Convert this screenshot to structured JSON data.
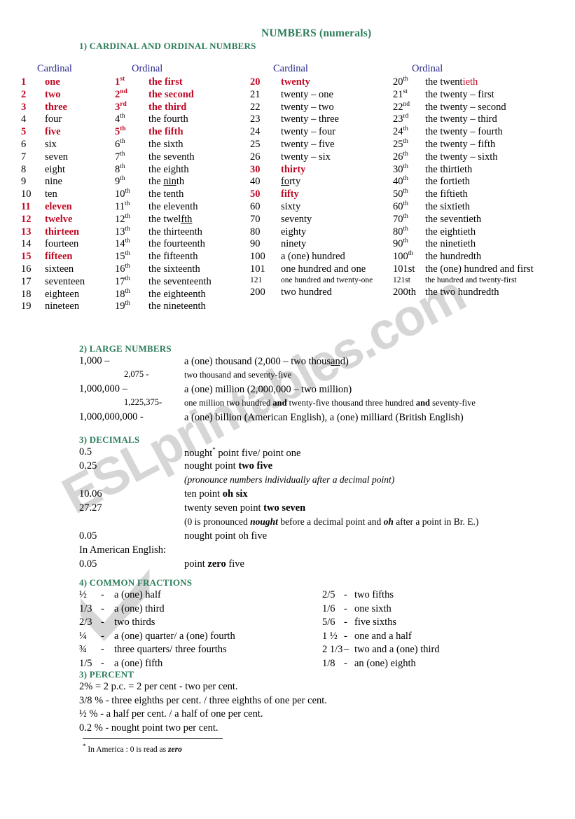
{
  "title": "NUMBERS (numerals)",
  "sections": {
    "cardinal_ordinal": "1) CARDINAL AND ORDINAL NUMBERS",
    "large_numbers": "2) LARGE NUMBERS",
    "decimals": "3) DECIMALS",
    "common_fractions": "4) COMMON FRACTIONS",
    "percent": "3) PERCENT"
  },
  "column_headers": {
    "cardinal_left": "Cardinal",
    "ordinal_left": "Ordinal",
    "cardinal_right": "Cardinal",
    "ordinal_right": "Ordinal"
  },
  "colors": {
    "heading_green": "#2e7d5b",
    "column_header_blue": "#2a2a8c",
    "highlight_red": "#bf0a25",
    "watermark_grey": "#d6d6d6"
  },
  "table_left": [
    {
      "num": "1",
      "cardinal": "one",
      "ord_num": "1",
      "ord_sup": "st",
      "ordinal": "the first",
      "red": true
    },
    {
      "num": "2",
      "cardinal": "two",
      "ord_num": "2",
      "ord_sup": "nd",
      "ordinal": "the second",
      "red": true
    },
    {
      "num": "3",
      "cardinal": "three",
      "ord_num": "3",
      "ord_sup": "rd",
      "ordinal": "the third",
      "red": true
    },
    {
      "num": "4",
      "cardinal": "four",
      "ord_num": "4",
      "ord_sup": "th",
      "ordinal": "the fourth",
      "red": false
    },
    {
      "num": "5",
      "cardinal": "five",
      "ord_num": "5",
      "ord_sup": "th",
      "ordinal": "the fifth",
      "red": true,
      "ord_num_red": true
    },
    {
      "num": "6",
      "cardinal": "six",
      "ord_num": "6",
      "ord_sup": "th",
      "ordinal": "the sixth",
      "red": false
    },
    {
      "num": "7",
      "cardinal": "seven",
      "ord_num": "7",
      "ord_sup": "th",
      "ordinal": "the seventh",
      "red": false
    },
    {
      "num": "8",
      "cardinal": "eight",
      "ord_num": "8",
      "ord_sup": "th",
      "ordinal": "the eighth",
      "red": false
    },
    {
      "num": "9",
      "cardinal": "nine",
      "ord_num": "9",
      "ord_sup": "th",
      "ordinal": "the ninth",
      "red": false,
      "underline": "nin"
    },
    {
      "num": "10",
      "cardinal": "ten",
      "ord_num": "10",
      "ord_sup": "th",
      "ordinal": "the tenth",
      "red": false
    },
    {
      "num": "11",
      "cardinal": "eleven",
      "ord_num": "11",
      "ord_sup": "th",
      "ordinal": "the eleventh",
      "red": false,
      "num_red": true
    },
    {
      "num": "12",
      "cardinal": "twelve",
      "ord_num": "12",
      "ord_sup": "th",
      "ordinal": "the twelfth",
      "red": false,
      "num_red": true,
      "underline": "fth"
    },
    {
      "num": "13",
      "cardinal": "thirteen",
      "ord_num": "13",
      "ord_sup": "th",
      "ordinal": "the thirteenth",
      "red": false,
      "num_red": true
    },
    {
      "num": "14",
      "cardinal": "fourteen",
      "ord_num": "14",
      "ord_sup": "th",
      "ordinal": "the fourteenth",
      "red": false
    },
    {
      "num": "15",
      "cardinal": "fifteen",
      "ord_num": "15",
      "ord_sup": "th",
      "ordinal": "the fifteenth",
      "red": false,
      "num_red": true
    },
    {
      "num": "16",
      "cardinal": "sixteen",
      "ord_num": "16",
      "ord_sup": "th",
      "ordinal": "the sixteenth",
      "red": false
    },
    {
      "num": "17",
      "cardinal": "seventeen",
      "ord_num": "17",
      "ord_sup": "th",
      "ordinal": "the seventeenth",
      "red": false
    },
    {
      "num": "18",
      "cardinal": "eighteen",
      "ord_num": "18",
      "ord_sup": "th",
      "ordinal": "the eighteenth",
      "red": false
    },
    {
      "num": "19",
      "cardinal": "nineteen",
      "ord_num": "19",
      "ord_sup": "th",
      "ordinal": "the nineteenth",
      "red": false
    }
  ],
  "table_right": [
    {
      "num": "20",
      "cardinal": "twenty",
      "ord_num": "20",
      "ord_sup": "th",
      "ordinal": "the twentieth",
      "num_red": true,
      "ordinal_red_tail": "ieth"
    },
    {
      "num": "21",
      "cardinal": "twenty – one",
      "ord_num": "21",
      "ord_sup": "st",
      "ordinal": "the twenty – first"
    },
    {
      "num": "22",
      "cardinal": "twenty – two",
      "ord_num": "22",
      "ord_sup": "nd",
      "ordinal": "the twenty – second"
    },
    {
      "num": "23",
      "cardinal": "twenty – three",
      "ord_num": "23",
      "ord_sup": "rd",
      "ordinal": "the twenty – third"
    },
    {
      "num": "24",
      "cardinal": "twenty – four",
      "ord_num": "24",
      "ord_sup": "th",
      "ordinal": "the twenty – fourth"
    },
    {
      "num": "25",
      "cardinal": "twenty – five",
      "ord_num": "25",
      "ord_sup": "th",
      "ordinal": "the twenty – fifth"
    },
    {
      "num": "26",
      "cardinal": "twenty – six",
      "ord_num": "26",
      "ord_sup": "th",
      "ordinal": "the twenty – sixth"
    },
    {
      "num": "30",
      "cardinal": "thirty",
      "ord_num": "30",
      "ord_sup": "th",
      "ordinal": "the thirtieth",
      "num_red": true
    },
    {
      "num": "40",
      "cardinal": "forty",
      "ord_num": "40",
      "ord_sup": "th",
      "ordinal": "the fortieth",
      "underline_card": "fo"
    },
    {
      "num": "50",
      "cardinal": "fifty",
      "ord_num": "50",
      "ord_sup": "th",
      "ordinal": "the fiftieth",
      "num_red": true
    },
    {
      "num": "60",
      "cardinal": "sixty",
      "ord_num": "60",
      "ord_sup": "th",
      "ordinal": "the sixtieth"
    },
    {
      "num": "70",
      "cardinal": "seventy",
      "ord_num": "70",
      "ord_sup": "th",
      "ordinal": "the seventieth"
    },
    {
      "num": "80",
      "cardinal": "eighty",
      "ord_num": "80",
      "ord_sup": "th",
      "ordinal": "the eightieth"
    },
    {
      "num": "90",
      "cardinal": "ninety",
      "ord_num": "90",
      "ord_sup": "th",
      "ordinal": "the ninetieth"
    },
    {
      "num": "100",
      "cardinal": "a (one) hundred",
      "ord_num": "100",
      "ord_sup": "th",
      "ordinal": "the hundredth"
    },
    {
      "num": "101",
      "cardinal": "one hundred and one",
      "ord_num": "101st",
      "ord_sup": "",
      "ordinal": "the (one) hundred and first"
    },
    {
      "num": "121",
      "cardinal": "one hundred and twenty-one",
      "ord_num": "121st",
      "ord_sup": "",
      "ordinal": "the hundred and twenty-first",
      "small": true
    },
    {
      "num": "200",
      "cardinal": "two hundred",
      "ord_num": "200th",
      "ord_sup": "",
      "ordinal": "the two hundredth"
    }
  ],
  "large_numbers": [
    {
      "label": "1,000 –",
      "indent": 0,
      "value_plain": "a (one) thousand (2,000 – two thousand)"
    },
    {
      "label": "2,075 -",
      "indent": 64,
      "value_plain": "two thousand and seventy-five",
      "small": true
    },
    {
      "label": "1,000,000 –",
      "indent": 0,
      "value_plain": "a (one) million    (2,000,000 – two million)"
    },
    {
      "label": "1,225,375-",
      "indent": 64,
      "value_plain": "one million two hundred and twenty-five thousand three hundred and seventy-five",
      "small": true,
      "bold_words": [
        "and"
      ]
    },
    {
      "label": "1,000,000,000 -",
      "indent": 0,
      "value_plain": "a (one) billion (American English), a (one) milliard (British English)"
    }
  ],
  "decimals": [
    {
      "label": "0.5",
      "value": "nought* point five/ point one"
    },
    {
      "label": "0.25",
      "value": "nought point two five"
    },
    {
      "label": "",
      "value": "(pronounce numbers individually after a decimal point)",
      "italic": true
    },
    {
      "label": "10.06",
      "value": "ten point oh six"
    },
    {
      "label": "27.27",
      "value": "twenty seven point two seven"
    },
    {
      "label": "",
      "value": "(0 is pronounced nought before a decimal point and oh after a point in Br. E.)"
    },
    {
      "label": "0.05",
      "value": "nought point oh five"
    },
    {
      "label": "In American English:",
      "value": "",
      "full_width": true
    },
    {
      "label": "0.05",
      "value": "point zero five"
    }
  ],
  "fractions_left": [
    {
      "frac": "½",
      "dash": "-",
      "text": "a (one) half"
    },
    {
      "frac": "1/3",
      "dash": "-",
      "text": "a (one) third"
    },
    {
      "frac": "2/3",
      "dash": "-",
      "text": "two thirds"
    },
    {
      "frac": "¼",
      "dash": "-",
      "text": "a (one) quarter/ a (one) fourth"
    },
    {
      "frac": "¾",
      "dash": "-",
      "text": "three quarters/ three fourths"
    },
    {
      "frac": "1/5",
      "dash": "-",
      "text": "a (one) fifth"
    }
  ],
  "fractions_right": [
    {
      "frac": "2/5",
      "dash": "-",
      "text": "two fifths"
    },
    {
      "frac": "1/6",
      "dash": "-",
      "text": "one sixth"
    },
    {
      "frac": "5/6",
      "dash": "-",
      "text": "five sixths"
    },
    {
      "frac": "1 ½",
      "dash": "-",
      "text": "one and a half"
    },
    {
      "frac": "2 1/3",
      "dash": "–",
      "text": "two and a (one) third"
    },
    {
      "frac": "1/8",
      "dash": "-",
      "text": "an (one) eighth"
    }
  ],
  "percent": [
    "2% = 2 p.c. = 2 per cent -   two per cent.",
    "3/8 % - three eighths per cent. / three eighths of one per cent.",
    "½ % - a half per cent. / a half of one per cent.",
    "0.2 % - nought point two per cent."
  ],
  "footnote": {
    "marker": "*",
    "text": "In America : 0 is read as ",
    "emphasis": "zero"
  },
  "watermark": {
    "text": "ESLprintables.com"
  }
}
